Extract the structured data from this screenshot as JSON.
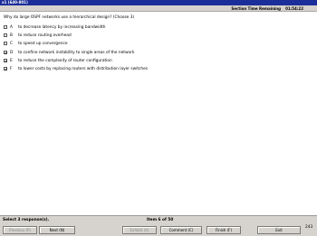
{
  "window": {
    "title": "x1  (640-801)"
  },
  "timer": {
    "label": "Section Time Remaining",
    "value": "01:54:22"
  },
  "question": {
    "text": "Why do large OSPF networks use a hierarchical design? (Choose 3)"
  },
  "options": [
    {
      "letter": "A",
      "text": "to decrease latency by increasing bandwidth",
      "checked": false,
      "mark": ""
    },
    {
      "letter": "B",
      "text": "to reduce routing overhead",
      "checked": false,
      "mark": ""
    },
    {
      "letter": "C",
      "text": "to speed up convergence",
      "checked": false,
      "mark": ""
    },
    {
      "letter": "D",
      "text": "to confine network instability to single areas of the network",
      "checked": true,
      "mark": "✔"
    },
    {
      "letter": "E",
      "text": "to reduce the complexity of router configuration",
      "checked": true,
      "mark": "✔"
    },
    {
      "letter": "F",
      "text": "to lower costs by replacing routers with distribution layer switches",
      "checked": true,
      "mark": "✔"
    }
  ],
  "status": {
    "select_text": "Select 3 response(s).",
    "item_text": "Item 6 of 50"
  },
  "buttons": {
    "previous": "Previous (P)",
    "next": "Next (N)",
    "exhibit": "Exhibit (X)",
    "comment": "Comment (C)",
    "finish": "Finish (F)",
    "exit": "Exit"
  },
  "corner_number": "243"
}
